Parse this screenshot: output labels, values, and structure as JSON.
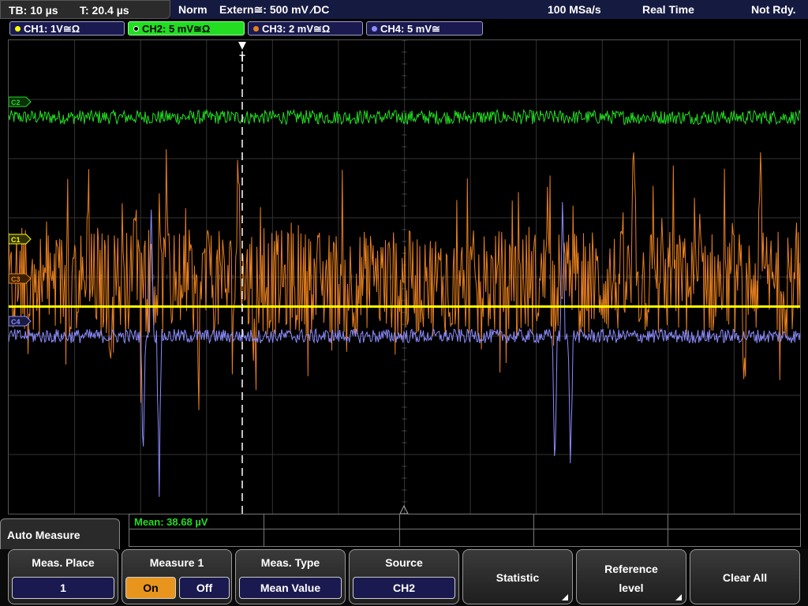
{
  "topbar": {
    "timebase": "TB: 10 µs",
    "trigger_time": "T: 20.4 µs",
    "mode": "Norm",
    "trigger_source": "Extern≅: 500 mV ⁄DC",
    "sample_rate": "100 MSa/s",
    "acq_mode": "Real Time",
    "status": "Not Rdy."
  },
  "channels": [
    {
      "label": "CH1: 1V≅Ω",
      "color": "#ffff00"
    },
    {
      "label": "CH2: 5 mV≅Ω",
      "color": "#22dd22"
    },
    {
      "label": "CH3: 2 mV≅Ω",
      "color": "#e8801e"
    },
    {
      "label": "CH4: 5 mV≅",
      "color": "#8b8bff"
    }
  ],
  "markers": {
    "c1": "C1",
    "c2": "C2",
    "c3": "C3",
    "c4": "C4",
    "trigger": "T"
  },
  "measurement": {
    "result": "Mean: 38.68 µV"
  },
  "menu": {
    "title": "Auto Measure"
  },
  "softkeys": {
    "meas_place_label": "Meas. Place",
    "meas_place_value": "1",
    "measure1_label": "Measure 1",
    "on_label": "On",
    "off_label": "Off",
    "meas_type_label": "Meas. Type",
    "meas_type_value": "Mean Value",
    "source_label": "Source",
    "source_value": "CH2",
    "statistic_label": "Statistic",
    "reference_label_1": "Reference",
    "reference_label_2": "level",
    "clear_all_label": "Clear All"
  },
  "chart_data": {
    "type": "line",
    "x_divisions": 12,
    "y_divisions": 8,
    "grid": true,
    "series": [
      {
        "name": "CH2",
        "color": "#22dd22",
        "level_div": 6.7,
        "noise_div": 0.12,
        "spikes": []
      },
      {
        "name": "CH3",
        "color": "#e8801e",
        "level_div": 3.9,
        "noise_div": 0.9,
        "spikes": [
          [
            0.1,
            2.4
          ],
          [
            0.13,
            -1.8
          ],
          [
            0.16,
            2.1
          ],
          [
            0.2,
            2.2
          ],
          [
            0.24,
            -1.9
          ],
          [
            0.29,
            2.3
          ],
          [
            0.31,
            -1.4
          ],
          [
            0.68,
            1.9
          ],
          [
            0.79,
            2.0
          ],
          [
            0.84,
            1.6
          ],
          [
            0.93,
            -1.7
          ],
          [
            0.95,
            1.8
          ]
        ]
      },
      {
        "name": "CH4",
        "color": "#8b8bff",
        "level_div": 3.0,
        "noise_div": 0.12,
        "spikes": [
          [
            0.17,
            -3.0
          ],
          [
            0.18,
            3.1
          ],
          [
            0.19,
            -3.0
          ],
          [
            0.69,
            -3.0
          ],
          [
            0.7,
            3.0
          ],
          [
            0.71,
            -2.8
          ]
        ]
      },
      {
        "name": "CH1",
        "color": "#ffff00",
        "level_div": 3.5,
        "noise_div": 0.0,
        "spikes": []
      }
    ]
  }
}
